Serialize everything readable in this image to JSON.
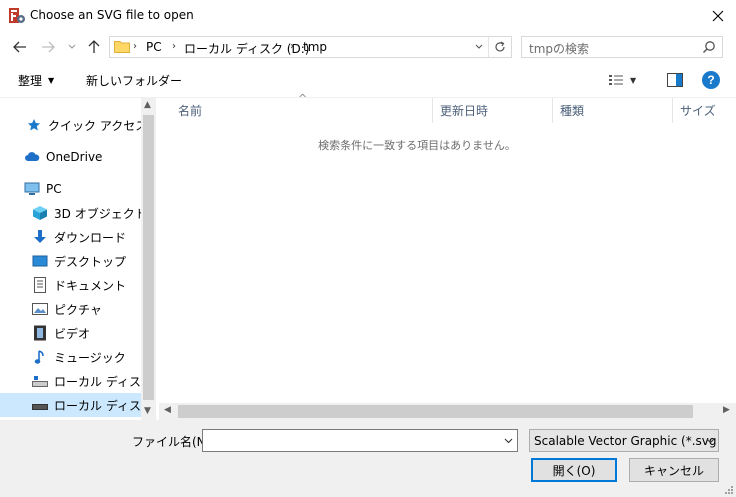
{
  "window": {
    "title": "Choose an SVG file to open",
    "close_glyph": "✕"
  },
  "nav": {
    "back_glyph": "←",
    "forward_glyph": "→",
    "recent_glyph": "⌄",
    "up_glyph": "↑",
    "breadcrumb": [
      "PC",
      "ローカル ディスク (D:)",
      "tmp"
    ],
    "separator_glyph": "›",
    "dropdown_glyph": "⌄",
    "refresh_glyph": "↻",
    "search_placeholder": "tmpの検索"
  },
  "toolbar": {
    "organize_label": "整理",
    "organize_arrow": "▼",
    "new_folder_label": "新しいフォルダー",
    "view_arrow": "▼",
    "help_label": "?"
  },
  "sidebar": {
    "items": [
      {
        "label": "クイック アクセス",
        "icon": "star-icon"
      },
      {
        "label": "OneDrive",
        "icon": "cloud-icon"
      },
      {
        "label": "PC",
        "icon": "computer-icon"
      },
      {
        "label": "3D オブジェクト",
        "icon": "cube-icon"
      },
      {
        "label": "ダウンロード",
        "icon": "download-icon"
      },
      {
        "label": "デスクトップ",
        "icon": "desktop-icon"
      },
      {
        "label": "ドキュメント",
        "icon": "document-icon"
      },
      {
        "label": "ピクチャ",
        "icon": "picture-icon"
      },
      {
        "label": "ビデオ",
        "icon": "video-icon"
      },
      {
        "label": "ミュージック",
        "icon": "music-icon"
      },
      {
        "label": "ローカル ディスク (C",
        "icon": "drive-icon"
      },
      {
        "label": "ローカル ディスク (D",
        "icon": "drive-icon",
        "selected": true
      }
    ],
    "scroll_up": "▲",
    "scroll_down": "▼"
  },
  "filelist": {
    "columns": [
      "名前",
      "更新日時",
      "種類",
      "サイズ"
    ],
    "sort_indicator": "^",
    "empty_message": "検索条件に一致する項目はありません。",
    "scroll_left": "◀",
    "scroll_right": "▶"
  },
  "bottom": {
    "filename_label": "ファイル名(N):",
    "filename_value": "",
    "filename_dropdown": "⌄",
    "filetype_selected": "Scalable Vector Graphic (*.svg *",
    "filetype_arrow": "⌄",
    "open_label": "開く(O)",
    "cancel_label": "キャンセル"
  },
  "colors": {
    "accent": "#0078d7",
    "selection": "#cce8ff",
    "help_icon": "#1979ca",
    "folder": "#ffd766",
    "column_header_text": "#4c607a"
  }
}
